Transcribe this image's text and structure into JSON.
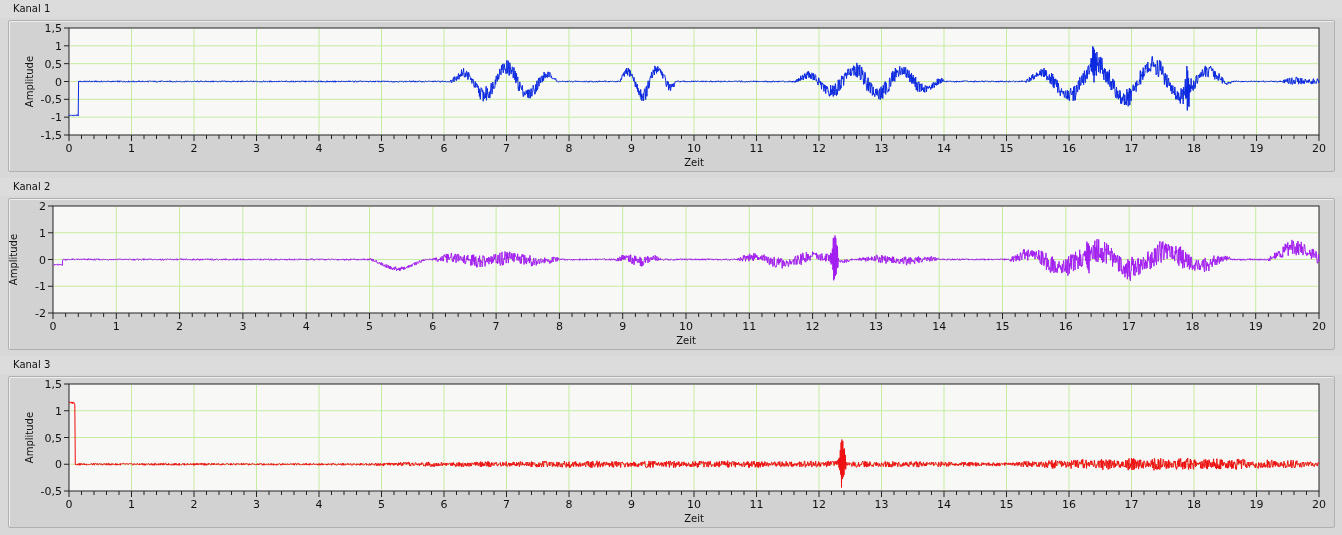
{
  "channels": [
    {
      "title": "Kanal 1",
      "ylabel": "Amplitude",
      "xlabel": "Zeit",
      "color": "#0a28e0",
      "yticks": [
        "1,5",
        "1",
        "0,5",
        "0",
        "-0,5",
        "-1",
        "-1,5"
      ],
      "xticks": [
        "0",
        "1",
        "2",
        "3",
        "4",
        "5",
        "6",
        "7",
        "8",
        "9",
        "10",
        "11",
        "12",
        "13",
        "14",
        "15",
        "16",
        "17",
        "18",
        "19",
        "20"
      ]
    },
    {
      "title": "Kanal 2",
      "ylabel": "Amplitude",
      "xlabel": "Zeit",
      "color": "#a21ef0",
      "yticks": [
        "2",
        "1",
        "0",
        "-1",
        "-2"
      ],
      "xticks": [
        "0",
        "1",
        "2",
        "3",
        "4",
        "5",
        "6",
        "7",
        "8",
        "9",
        "10",
        "11",
        "12",
        "13",
        "14",
        "15",
        "16",
        "17",
        "18",
        "19",
        "20"
      ]
    },
    {
      "title": "Kanal 3",
      "ylabel": "Amplitude",
      "xlabel": "Zeit",
      "color": "#ee1010",
      "yticks": [
        "1,5",
        "1",
        "0,5",
        "0",
        "-0,5"
      ],
      "xticks": [
        "0",
        "1",
        "2",
        "3",
        "4",
        "5",
        "6",
        "7",
        "8",
        "9",
        "10",
        "11",
        "12",
        "13",
        "14",
        "15",
        "16",
        "17",
        "18",
        "19",
        "20"
      ]
    }
  ]
}
